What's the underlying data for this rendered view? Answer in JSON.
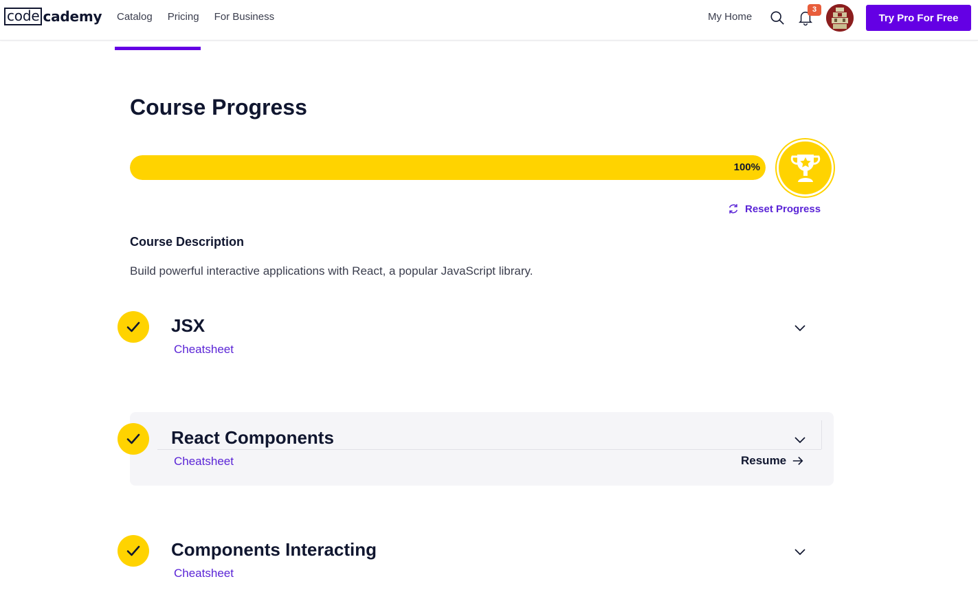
{
  "header": {
    "logo_box": "code",
    "logo_rest": "cademy",
    "nav": [
      "Catalog",
      "Pricing",
      "For Business"
    ],
    "my_home": "My Home",
    "notification_count": "3",
    "cta": "Try Pro For Free"
  },
  "progress": {
    "title": "Course Progress",
    "percent": 100,
    "label": "100%",
    "reset_label": "Reset Progress"
  },
  "description": {
    "heading": "Course Description",
    "text": "Build powerful interactive applications with React, a popular JavaScript library."
  },
  "modules": [
    {
      "title": "JSX",
      "cheatsheet": "Cheatsheet",
      "completed": true
    },
    {
      "title": "React Components",
      "cheatsheet": "Cheatsheet",
      "completed": true,
      "resume": "Resume"
    },
    {
      "title": "Components Interacting",
      "cheatsheet": "Cheatsheet",
      "completed": true
    }
  ],
  "colors": {
    "brand_purple": "#6400e4",
    "link_purple": "#5a24d6",
    "accent_yellow": "#ffd300",
    "ink": "#10162f"
  }
}
